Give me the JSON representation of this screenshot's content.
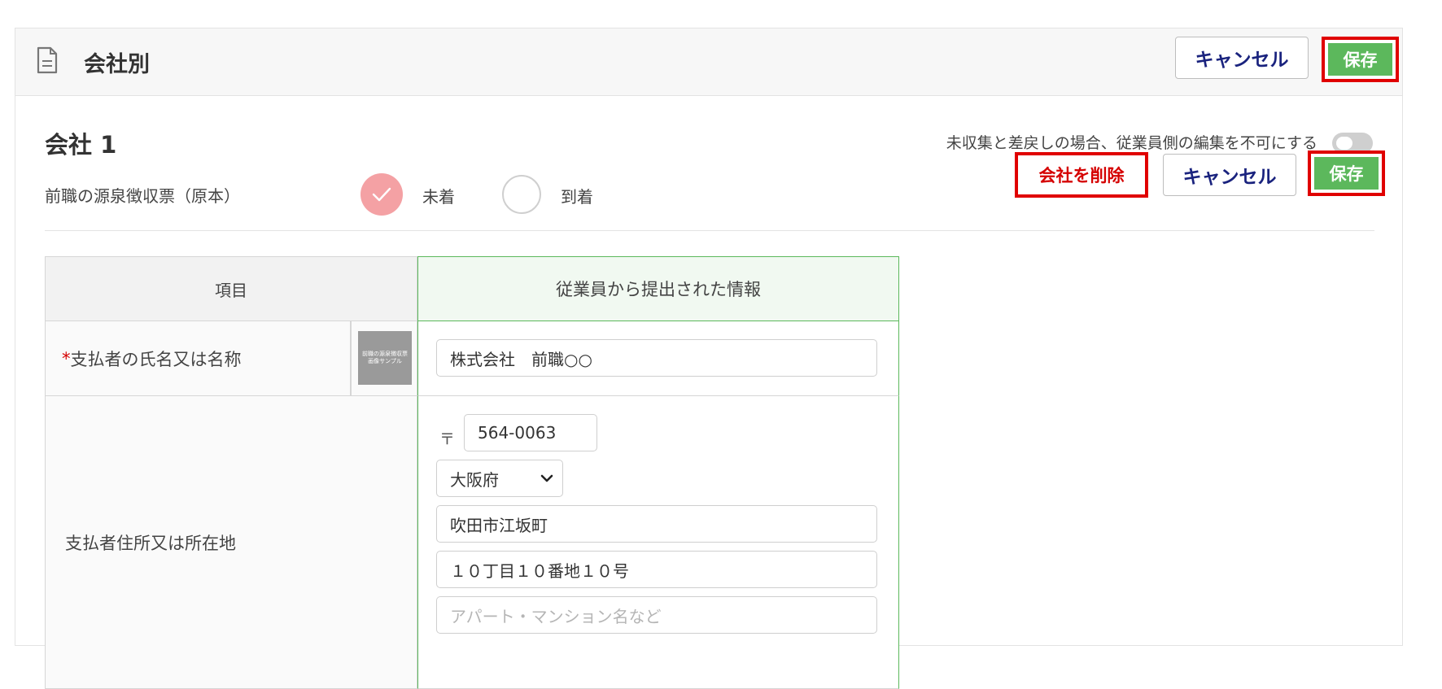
{
  "header": {
    "title": "会社別",
    "cancel_label": "キャンセル",
    "save_label": "保存"
  },
  "company": {
    "title": "会社 1",
    "lock_label": "未収集と差戻しの場合、従業員側の編集を不可にする",
    "lock_enabled": false,
    "receipt_label": "前職の源泉徴収票（原本）",
    "status_options": [
      "未着",
      "到着"
    ],
    "status_selected": "未着",
    "delete_label": "会社を削除",
    "cancel_label": "キャンセル",
    "save_label": "保存"
  },
  "table": {
    "headers": [
      "項目",
      "従業員から提出された情報"
    ],
    "rows": [
      {
        "required_mark": "*",
        "label": "支払者の氏名又は名称",
        "thumbnail_text": [
          "前職の源泉徴収票",
          "画像サンプル"
        ],
        "value": "株式会社　前職○○"
      },
      {
        "label": "支払者住所又は所在地",
        "postal_mark": "〒",
        "postal_code": "564-0063",
        "prefecture": "大阪府",
        "city": "吹田市江坂町",
        "street": "１０丁目１０番地１０号",
        "building_placeholder": "アパート・マンション名など"
      }
    ]
  },
  "colors": {
    "save_green": "#5cb85c",
    "highlight_red": "#e00000",
    "delete_text": "#d50000",
    "cancel_text": "#1a237e",
    "checked_radio": "#f4a1a4"
  },
  "icons": {
    "header": "document-icon",
    "radio_check": "check-icon",
    "select": "chevron-down-icon"
  }
}
